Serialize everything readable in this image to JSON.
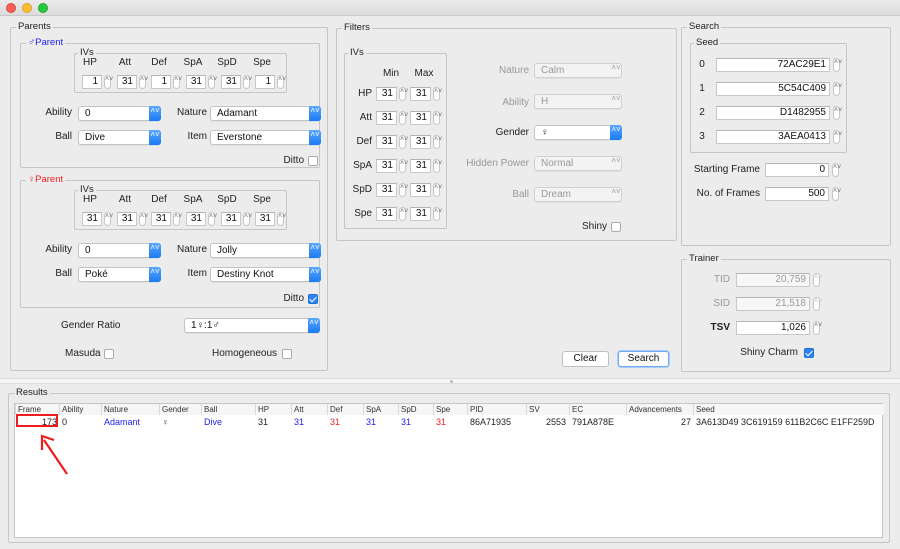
{
  "window": {
    "controls": [
      "close",
      "minimize",
      "zoom"
    ]
  },
  "parents": {
    "title": "Parents",
    "iv_headers": [
      "HP",
      "Att",
      "Def",
      "SpA",
      "SpD",
      "Spe"
    ],
    "male": {
      "title": "♂Parent",
      "ivs_label": "IVs",
      "ivs": [
        "1",
        "31",
        "1",
        "31",
        "31",
        "1"
      ],
      "ability_label": "Ability",
      "ability": "0",
      "nature_label": "Nature",
      "nature": "Adamant",
      "ball_label": "Ball",
      "ball": "Dive",
      "item_label": "Item",
      "item": "Everstone",
      "ditto_label": "Ditto",
      "ditto": false
    },
    "female": {
      "title": "♀Parent",
      "ivs_label": "IVs",
      "ivs": [
        "31",
        "31",
        "31",
        "31",
        "31",
        "31"
      ],
      "ability_label": "Ability",
      "ability": "0",
      "nature_label": "Nature",
      "nature": "Jolly",
      "ball_label": "Ball",
      "ball": "Poké",
      "item_label": "Item",
      "item": "Destiny Knot",
      "ditto_label": "Ditto",
      "ditto": true
    },
    "gender_ratio_label": "Gender Ratio",
    "gender_ratio": "1♀:1♂",
    "masuda_label": "Masuda",
    "masuda": false,
    "homogeneous_label": "Homogeneous",
    "homogeneous": false
  },
  "filters": {
    "title": "Filters",
    "ivs_label": "IVs",
    "min_label": "Min",
    "max_label": "Max",
    "stats": [
      {
        "name": "HP",
        "min": "31",
        "max": "31"
      },
      {
        "name": "Att",
        "min": "31",
        "max": "31"
      },
      {
        "name": "Def",
        "min": "31",
        "max": "31"
      },
      {
        "name": "SpA",
        "min": "31",
        "max": "31"
      },
      {
        "name": "SpD",
        "min": "31",
        "max": "31"
      },
      {
        "name": "Spe",
        "min": "31",
        "max": "31"
      }
    ],
    "nature_label": "Nature",
    "nature": "Calm",
    "ability_label": "Ability",
    "ability": "H",
    "gender_label": "Gender",
    "gender": "♀",
    "hidden_power_label": "Hidden Power",
    "hidden_power": "Normal",
    "ball_label": "Ball",
    "ball": "Dream",
    "shiny_label": "Shiny",
    "shiny": false,
    "clear_button": "Clear",
    "search_button": "Search"
  },
  "search": {
    "title": "Search",
    "seed_label": "Seed",
    "seeds": [
      {
        "index": "0",
        "value": "72AC29E1"
      },
      {
        "index": "1",
        "value": "5C54C409"
      },
      {
        "index": "2",
        "value": "D1482955"
      },
      {
        "index": "3",
        "value": "3AEA0413"
      }
    ],
    "starting_frame_label": "Starting Frame",
    "starting_frame": "0",
    "num_frames_label": "No. of Frames",
    "num_frames": "500"
  },
  "trainer": {
    "title": "Trainer",
    "tid_label": "TID",
    "tid": "20,759",
    "sid_label": "SID",
    "sid": "21,518",
    "tsv_label": "TSV",
    "tsv": "1,026",
    "shiny_charm_label": "Shiny Charm",
    "shiny_charm": true
  },
  "results": {
    "title": "Results",
    "columns": [
      "Frame",
      "Ability",
      "Nature",
      "Gender",
      "Ball",
      "HP",
      "Att",
      "Def",
      "SpA",
      "SpD",
      "Spe",
      "PID",
      "SV",
      "EC",
      "Advancements",
      "Seed"
    ],
    "rows": [
      {
        "frame": "173",
        "ability": "0",
        "nature": "Adamant",
        "gender": "♀",
        "ball": "Dive",
        "hp": "31",
        "att": "31",
        "def": "31",
        "spa": "31",
        "spd": "31",
        "spe": "31",
        "pid": "86A71935",
        "sv": "2553",
        "ec": "791A878E",
        "advancements": "27",
        "seed": "3A613D49 3C619159 611B2C6C E1FF259D"
      }
    ],
    "colors": {
      "inherited_male": "#2222ee",
      "inherited_female": "#ee2222",
      "annotation": "#ee1c1c"
    }
  }
}
